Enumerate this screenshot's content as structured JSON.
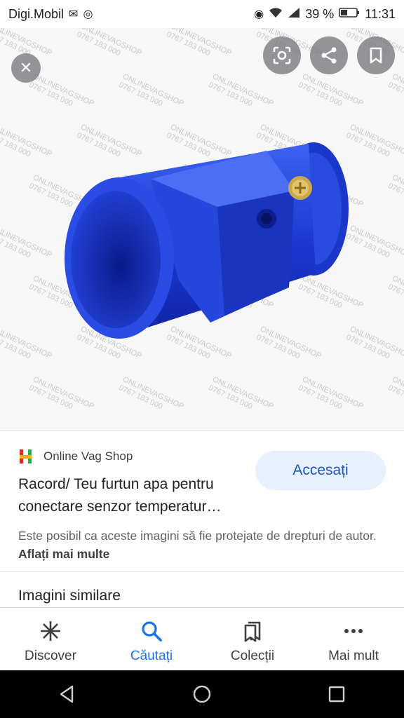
{
  "status_bar": {
    "carrier": "Digi.Mobil",
    "battery": "39 %",
    "time": "11:31",
    "icons": [
      "mail-icon",
      "whatsapp-icon",
      "eye-icon",
      "wifi-icon",
      "signal-icon",
      "battery-icon"
    ]
  },
  "viewer": {
    "watermark_name": "ONLINEVAGSHOP",
    "watermark_phone": "0767 183 000",
    "product_color": "#1e3fd6"
  },
  "result": {
    "source_name": "Online Vag Shop",
    "title_line1": "Racord/ Teu furtun apa pentru",
    "title_line2": "conectare senzor temperatur…",
    "access_label": "Accesați",
    "copyright_text": "Este posibil ca aceste imagini să fie protejate de drepturi de autor.",
    "learn_more": "Aflați mai multe",
    "similar_heading": "Imagini similare"
  },
  "bottom_nav": [
    {
      "label": "Discover",
      "icon": "asterisk-icon"
    },
    {
      "label": "Căutați",
      "icon": "search-icon"
    },
    {
      "label": "Colecții",
      "icon": "collections-icon"
    },
    {
      "label": "Mai mult",
      "icon": "more-icon"
    }
  ],
  "colors": {
    "accent": "#1a73e8",
    "button_bg": "#e8f0fe"
  }
}
